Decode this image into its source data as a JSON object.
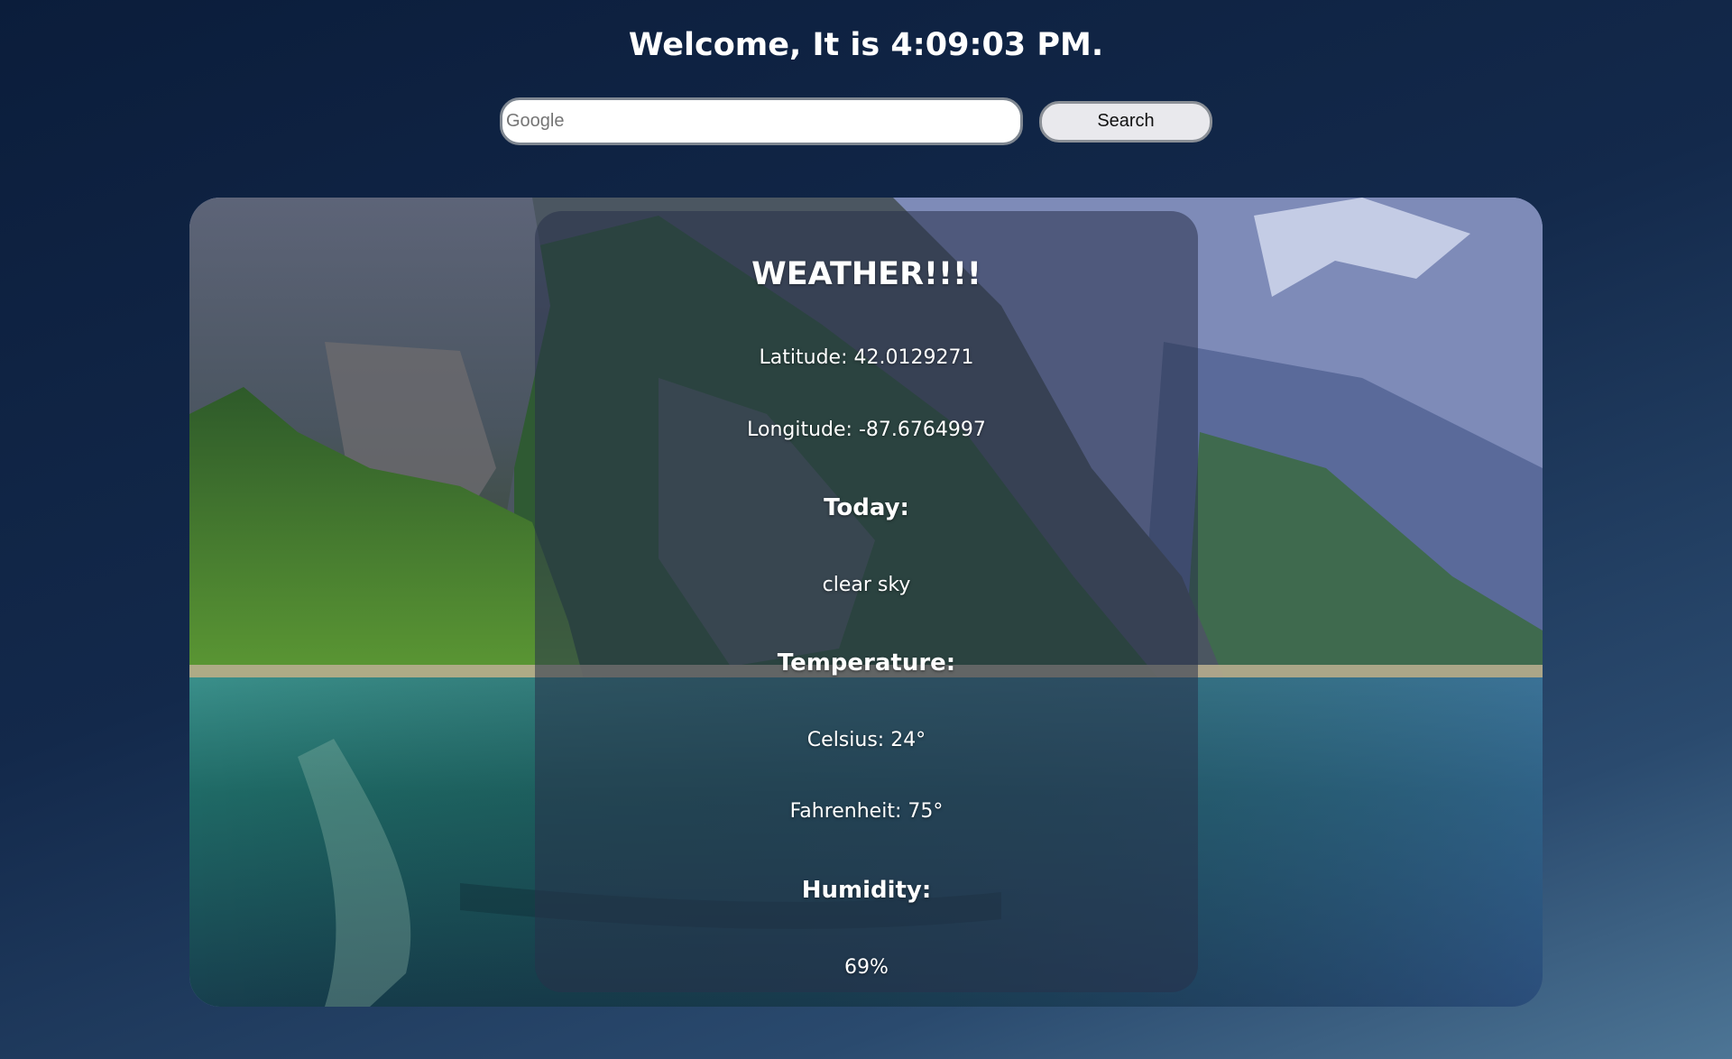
{
  "header": {
    "greeting": "Welcome, It is 4:09:03 PM."
  },
  "search": {
    "placeholder": "Google",
    "value": "",
    "button_label": "Search"
  },
  "weather": {
    "title": "WEATHER!!!!",
    "latitude": "Latitude: 42.0129271",
    "longitude": "Longitude: -87.6764997",
    "today_heading": "Today:",
    "condition": "clear sky",
    "temperature_heading": "Temperature:",
    "celsius": "Celsius: 24°",
    "fahrenheit": "Fahrenheit: 75°",
    "humidity_heading": "Humidity:",
    "humidity": "69%"
  }
}
